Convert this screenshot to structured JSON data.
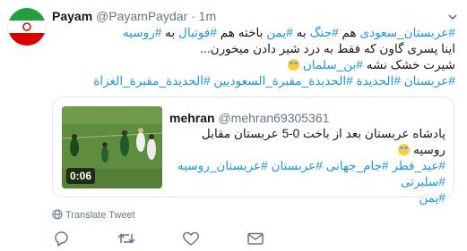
{
  "tweet": {
    "author_name": "Payam",
    "author_handle": "@PayamPaydar",
    "separator": "·",
    "time": "1m",
    "text_lines": [
      [
        {
          "t": "#عربستان_سعودی",
          "tag": true
        },
        {
          "t": " هم ",
          "tag": false
        },
        {
          "t": "#جنگ",
          "tag": true
        },
        {
          "t": " به ",
          "tag": false
        },
        {
          "t": "#یمن",
          "tag": true
        },
        {
          "t": " باخته هم ",
          "tag": false
        },
        {
          "t": "#فوتبال",
          "tag": true
        },
        {
          "t": " به ",
          "tag": false
        },
        {
          "t": "#روسیه",
          "tag": true
        }
      ],
      [
        {
          "t": "اینا پسری گاون که فقط به درد شیر دادن میخورن...",
          "tag": false
        }
      ],
      [
        {
          "t": "شیرت خشک نشه ",
          "tag": false
        },
        {
          "t": "#بن_سلمان",
          "tag": true
        },
        {
          "t": " ",
          "tag": false
        },
        {
          "t": "emoji",
          "tag": false,
          "emoji": true
        }
      ],
      [
        {
          "t": "#عربستان",
          "tag": true
        },
        {
          "t": " ",
          "tag": false
        },
        {
          "t": "#الحديدة",
          "tag": true
        },
        {
          "t": " ",
          "tag": false
        },
        {
          "t": "#الحديدة_مقبرة_السعوديين",
          "tag": true
        },
        {
          "t": " ",
          "tag": false
        },
        {
          "t": "#الحديدة_مقبرة_الغزاة",
          "tag": true
        }
      ]
    ]
  },
  "quoted": {
    "author_name": "mehran",
    "author_handle": "@mehran69305361",
    "video_duration": "0:06",
    "text_lines": [
      [
        {
          "t": "پادشاه عربستان بعد از باخت 0-5 عربستان مقابل روسیه ",
          "tag": false
        },
        {
          "t": "emoji",
          "tag": false,
          "emoji": true
        }
      ],
      [
        {
          "t": "#عید_فطر",
          "tag": true
        },
        {
          "t": " ",
          "tag": false
        },
        {
          "t": "#جام_جهانی",
          "tag": true
        },
        {
          "t": " ",
          "tag": false
        },
        {
          "t": "#عربستان",
          "tag": true
        },
        {
          "t": " ",
          "tag": false
        },
        {
          "t": "#عربستان_روسیه",
          "tag": true
        },
        {
          "t": " ",
          "tag": false
        },
        {
          "t": "#سلبرتی",
          "tag": true
        }
      ],
      [
        {
          "t": "#یمن",
          "tag": true
        }
      ]
    ]
  },
  "translate_label": "Translate Tweet",
  "icons": {
    "reply": "reply-icon",
    "retweet": "retweet-icon",
    "like": "heart-icon",
    "dm": "envelope-icon",
    "globe": "globe-icon",
    "caret": "chevron-down-icon"
  },
  "colors": {
    "hashtag": "#1b95e0",
    "muted": "#657786",
    "text": "#14171a",
    "border": "#e1e8ed"
  }
}
